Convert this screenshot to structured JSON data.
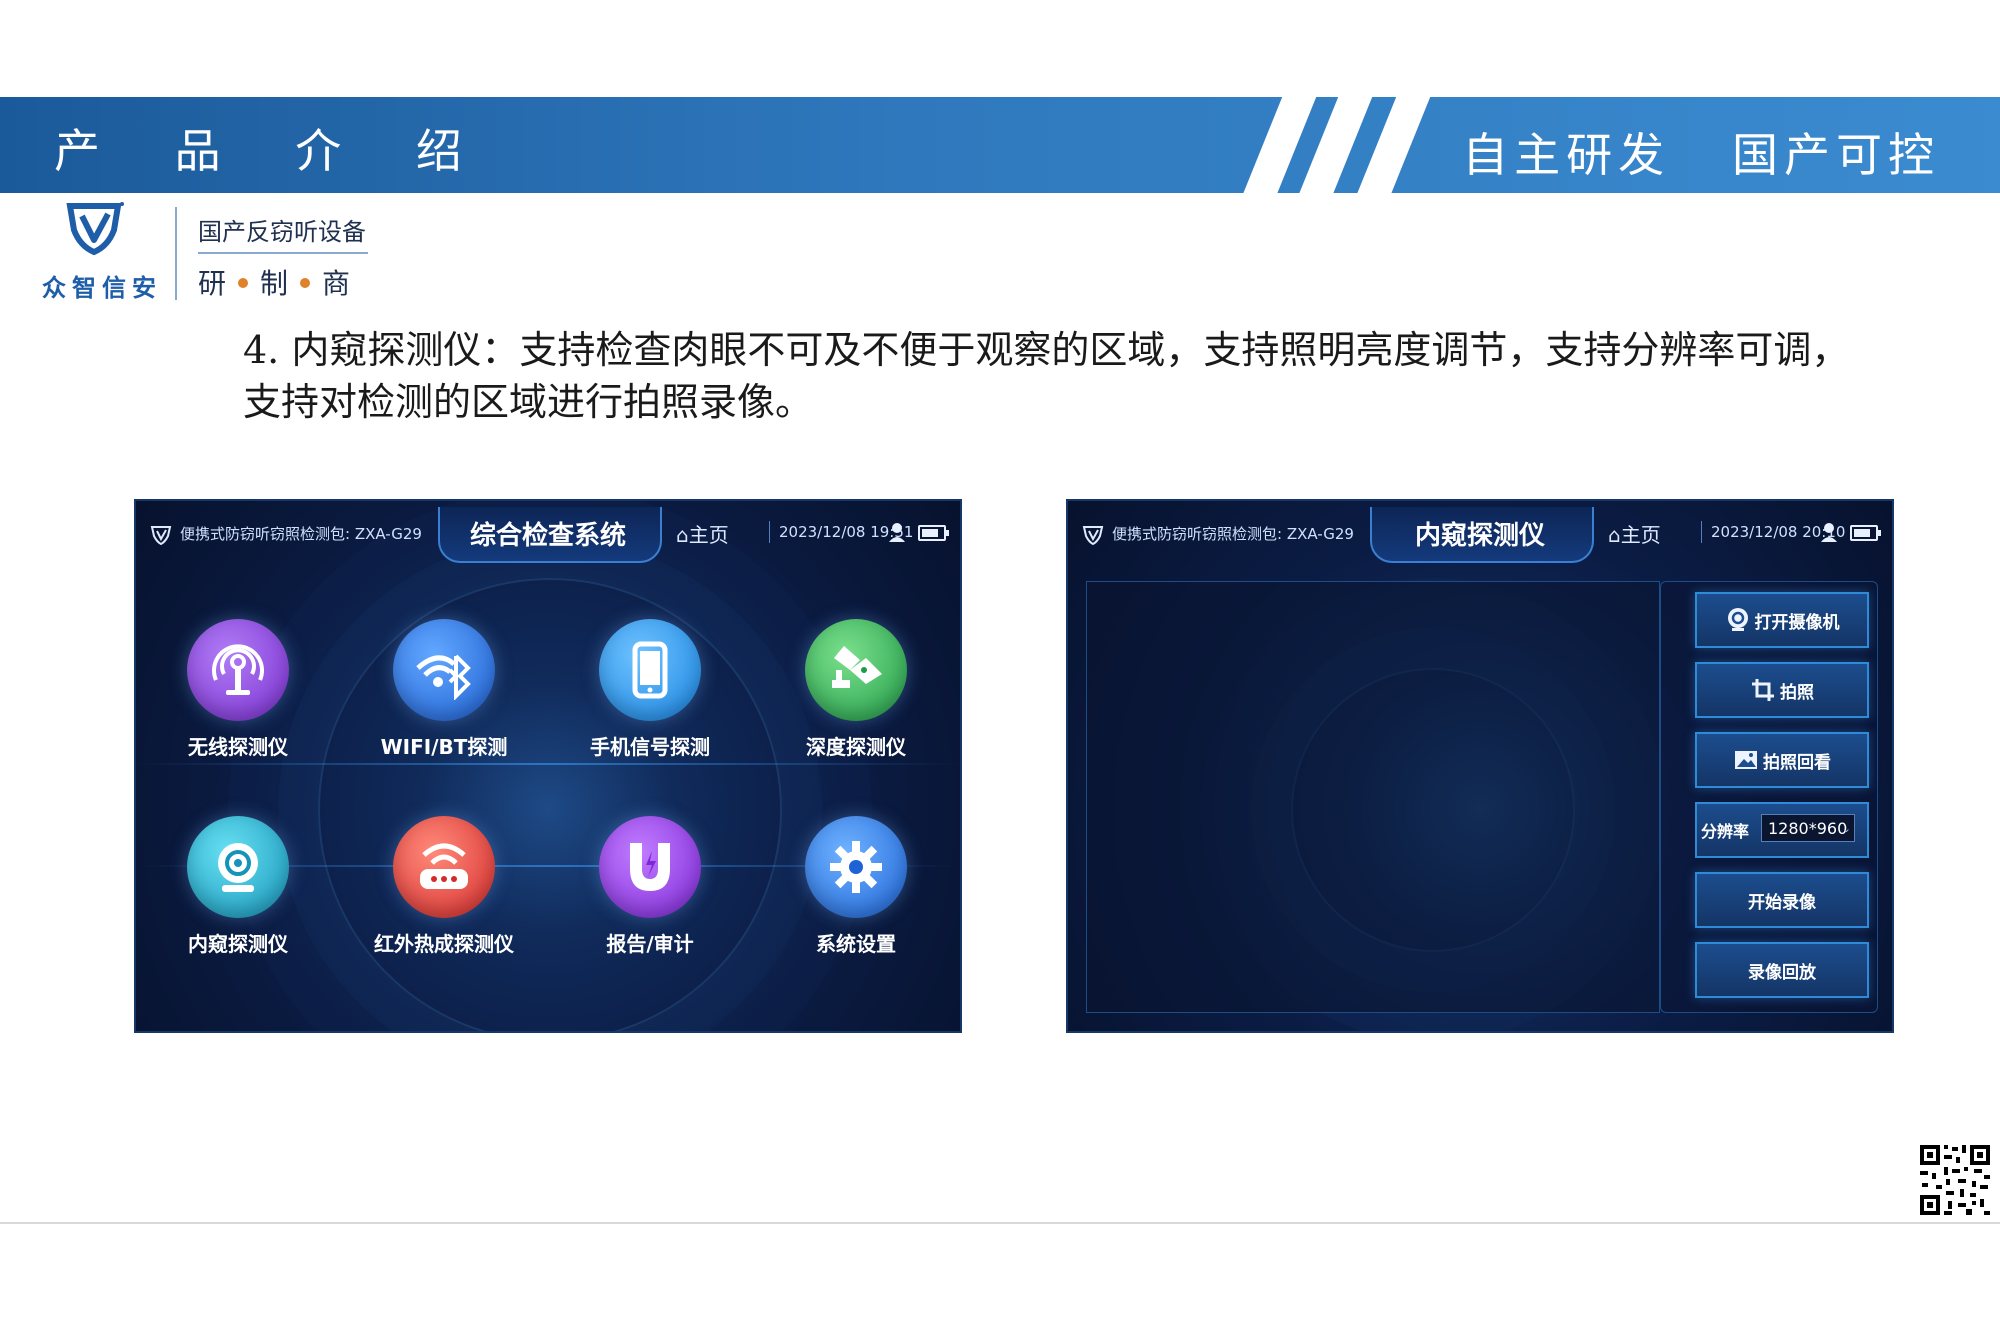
{
  "header": {
    "title": "产 品 介 绍",
    "slogan": "自主研发   国产可控",
    "colors": {
      "band": "#2f78bd",
      "brand": "#1e5ea8"
    }
  },
  "logo": {
    "name": "众智信安",
    "tagline": "国产反窃听设备",
    "roles": [
      "研",
      "制",
      "商"
    ],
    "icon": "shield-v-icon"
  },
  "description": "4. 内窥探测仪：支持检查肉眼不可及不便于观察的区域，支持照明亮度调节，支持分辨率可调，支持对检测的区域进行拍照录像。",
  "screen_left": {
    "product": "便携式防窃听窃照检测包: ZXA-G29",
    "title": "综合检查系统",
    "home": "主页",
    "datetime": "2023/12/08 19:51",
    "apps": [
      {
        "label": "无线探测仪",
        "icon": "antenna-icon",
        "color": "#8a3fd8"
      },
      {
        "label": "WIFI/BT探测",
        "icon": "wifi-bluetooth-icon",
        "color": "#2a76e0"
      },
      {
        "label": "手机信号探测",
        "icon": "phone-icon",
        "color": "#1f92e6"
      },
      {
        "label": "深度探测仪",
        "icon": "camera-detect-icon",
        "color": "#2bb05a"
      },
      {
        "label": "内窥探测仪",
        "icon": "endoscope-icon",
        "color": "#22a7c8"
      },
      {
        "label": "红外热成探测仪",
        "icon": "router-icon",
        "color": "#e23a3a"
      },
      {
        "label": "报告/审计",
        "icon": "magnet-icon",
        "color": "#9a3fe0"
      },
      {
        "label": "系统设置",
        "icon": "gear-icon",
        "color": "#2a78e0"
      }
    ]
  },
  "screen_right": {
    "product": "便携式防窃听窃照检测包: ZXA-G29",
    "title": "内窥探测仪",
    "home": "主页",
    "datetime": "2023/12/08 20:10",
    "buttons": {
      "open_camera": "打开摄像机",
      "capture": "拍照",
      "photo_review": "拍照回看",
      "resolution_label": "分辨率",
      "resolution_value": "1280*960",
      "start_record": "开始录像",
      "record_playback": "录像回放"
    }
  }
}
